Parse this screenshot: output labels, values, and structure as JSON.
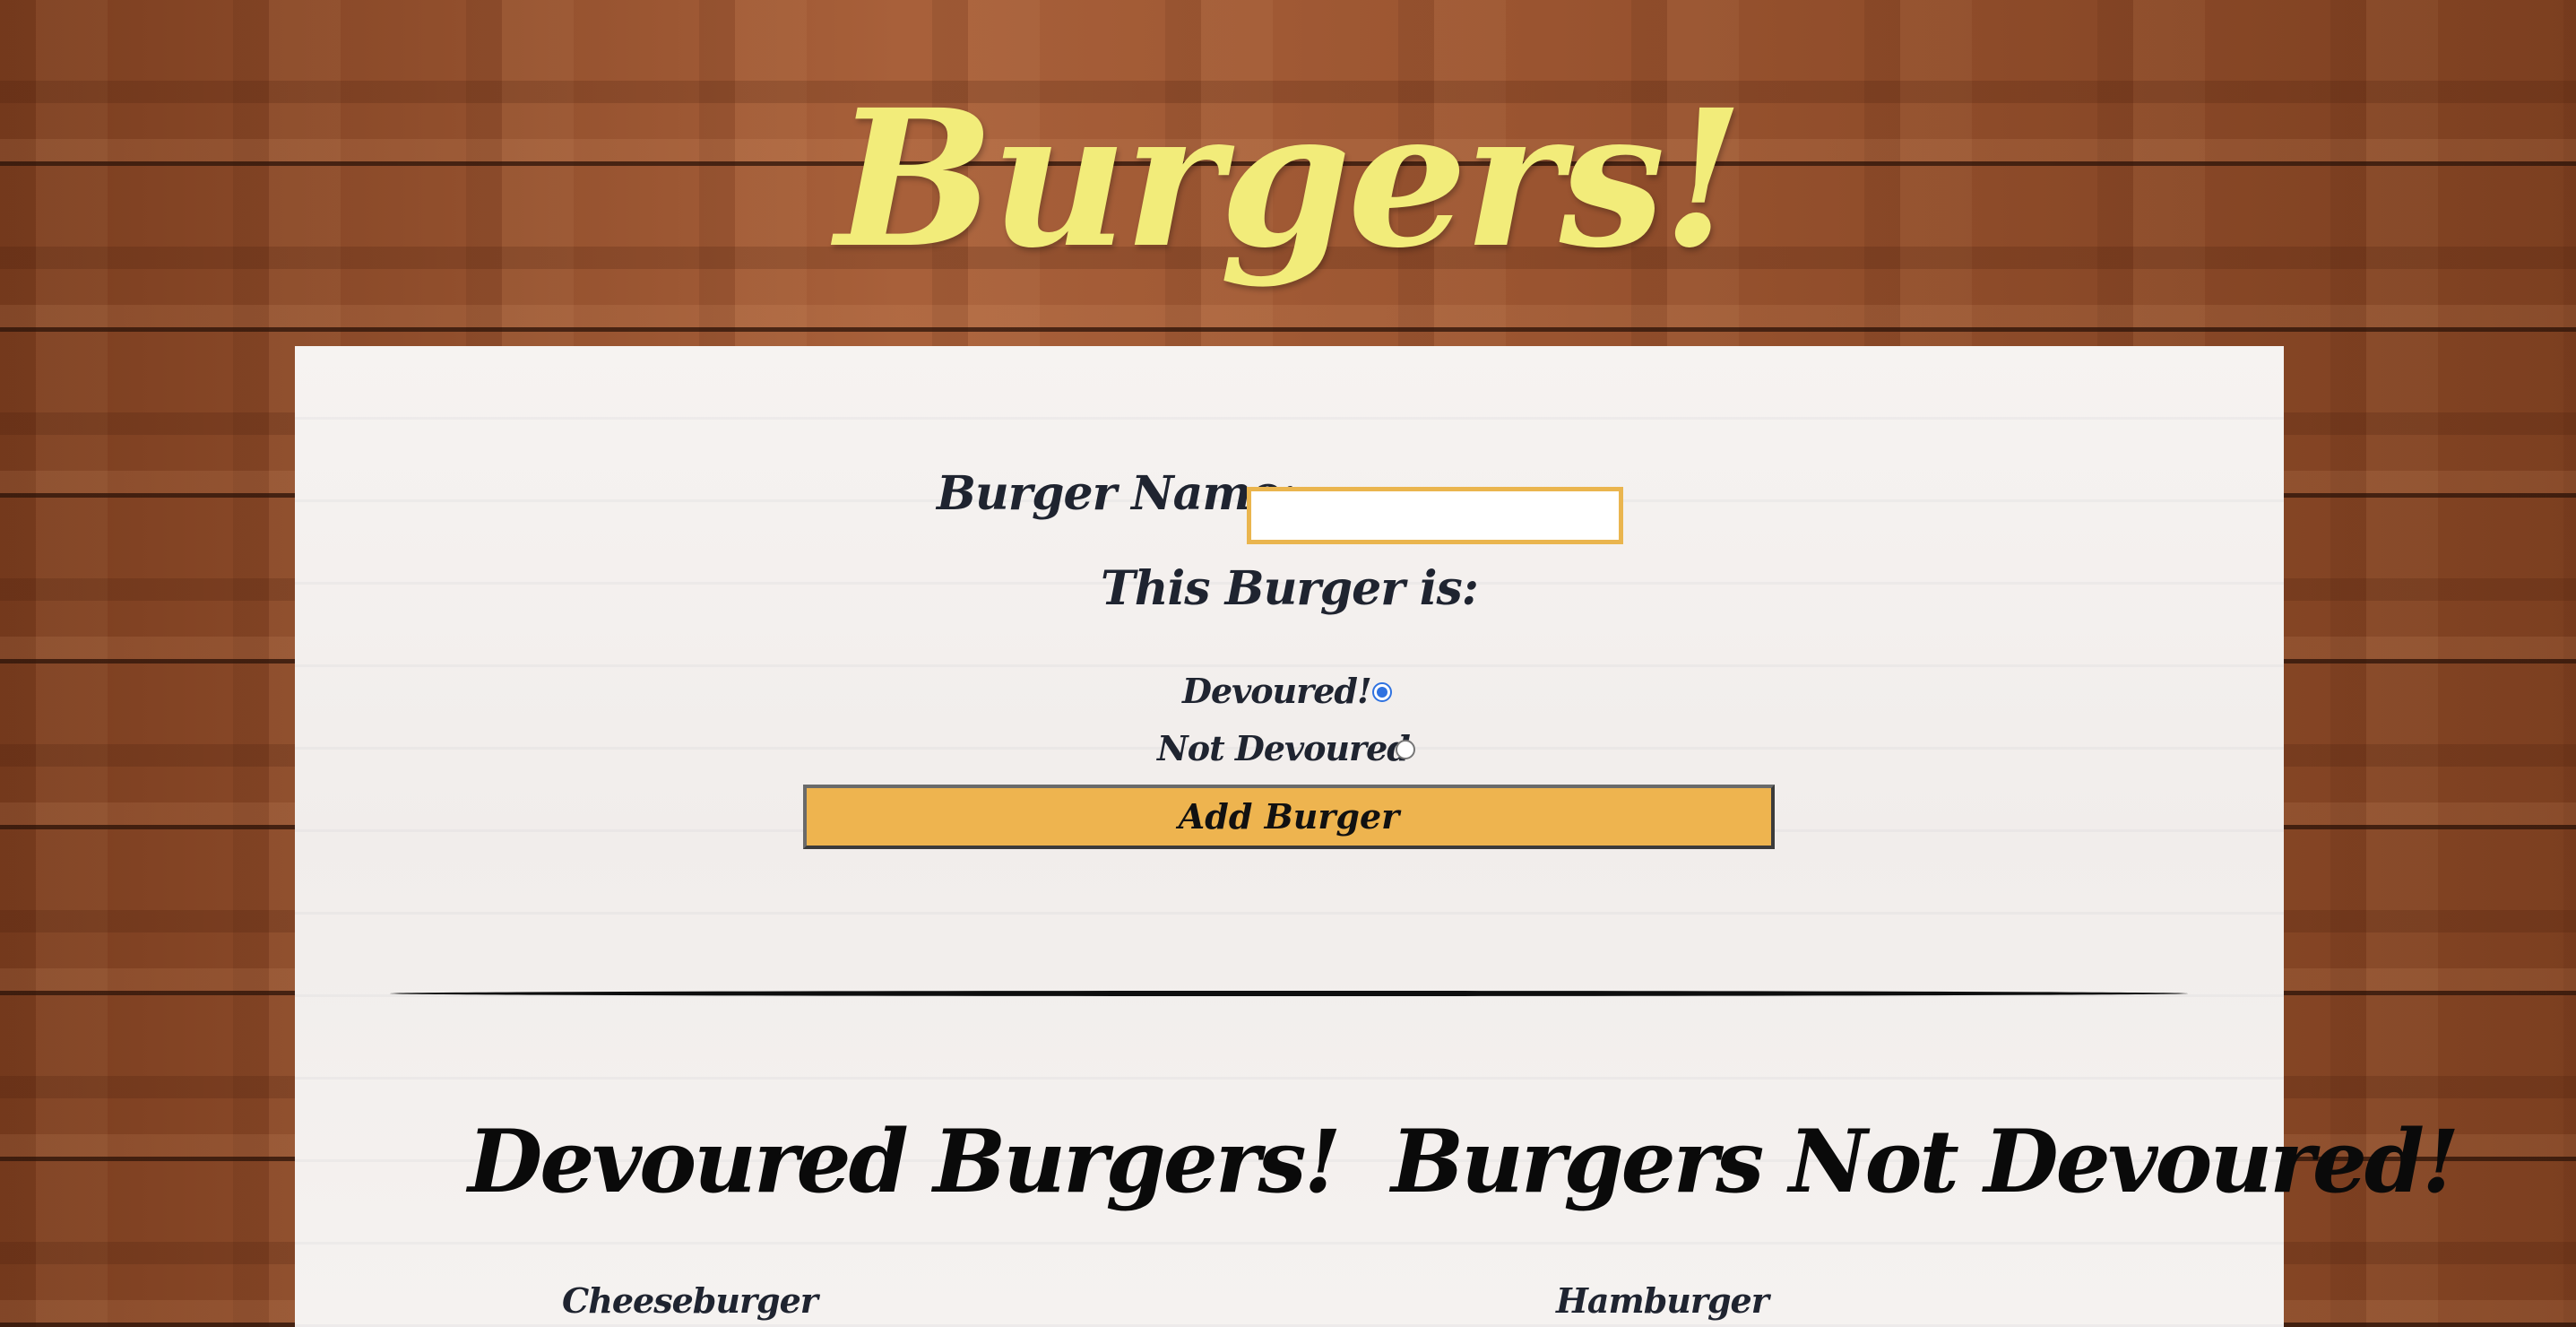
{
  "page": {
    "title": "Burgers!"
  },
  "form": {
    "name_label": "Burger Name:",
    "name_value": "",
    "name_placeholder": "",
    "status_heading": "This Burger is:",
    "radio_options": [
      {
        "label": "Devoured!",
        "checked": true
      },
      {
        "label": "Not Devoured",
        "checked": false
      }
    ],
    "submit_label": "Add Burger"
  },
  "columns": {
    "devoured": {
      "heading": "Devoured Burgers!",
      "items": [
        "Cheeseburger"
      ]
    },
    "not_devoured": {
      "heading": "Burgers Not Devoured!",
      "items": [
        "Hamburger"
      ]
    }
  },
  "colors": {
    "title": "#f2ec7a",
    "accent": "#eeb44f",
    "input_border": "#eab54e",
    "radio_selected": "#2f72e0",
    "text_dark": "#1f2430"
  }
}
